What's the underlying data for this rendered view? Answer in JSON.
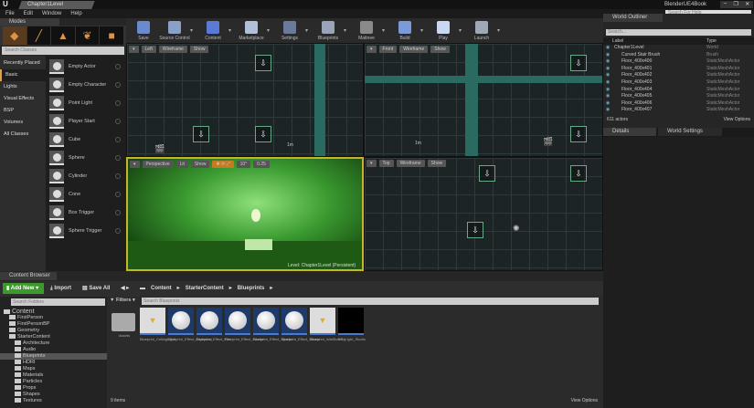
{
  "window": {
    "logo": "U",
    "doc_tab": "Chapter1Level",
    "app_title": "BlenderUE4Book",
    "search_web": "Search For Help",
    "controls": [
      "‒",
      "❐",
      "✕"
    ]
  },
  "menu": [
    "File",
    "Edit",
    "Window",
    "Help"
  ],
  "modes": {
    "tab": "Modes",
    "search_placeholder": "Search Classes",
    "mode_icons": [
      "place-mode",
      "paint-mode",
      "landscape-mode",
      "foliage-mode",
      "geometry-mode"
    ],
    "categories": [
      "Recently Placed",
      "Basic",
      "Lights",
      "Visual Effects",
      "BSP",
      "Volumes",
      "All Classes"
    ],
    "active_category": "Basic",
    "items": [
      "Empty Actor",
      "Empty Character",
      "Point Light",
      "Player Start",
      "Cube",
      "Sphere",
      "Cylinder",
      "Cone",
      "Box Trigger",
      "Sphere Trigger"
    ]
  },
  "toolbar": [
    {
      "label": "Save",
      "color": "#6a8ad0"
    },
    {
      "label": "Source Control",
      "color": "#8aa0c8"
    },
    {
      "label": "Content",
      "color": "#5a7ad8"
    },
    {
      "label": "Marketplace",
      "color": "#b0c0d8"
    },
    {
      "label": "Settings",
      "color": "#6a7a9a"
    },
    {
      "label": "Blueprints",
      "color": "#9aa4b8"
    },
    {
      "label": "Matinee",
      "color": "#8a8a8a"
    },
    {
      "label": "Build",
      "color": "#7a9ad8"
    },
    {
      "label": "Play",
      "color": "#c8d8f0"
    },
    {
      "label": "Launch",
      "color": "#a0a8b8"
    }
  ],
  "viewports": {
    "left": {
      "view": "Left",
      "mode": "Wireframe",
      "show": "Show",
      "scale": "1m"
    },
    "front": {
      "view": "Front",
      "mode": "Wireframe",
      "show": "Show",
      "scale": "1m"
    },
    "perspective": {
      "view": "Perspective",
      "mode": "Lit",
      "show": "Show",
      "angle": "10°",
      "scale": "0.25",
      "level_label": "Level:  Chapter1Level (Persistent)"
    },
    "top": {
      "view": "Top",
      "mode": "Wireframe",
      "show": "Show"
    }
  },
  "outliner": {
    "tab": "World Outliner",
    "search_placeholder": "Search...",
    "col_label": "Label",
    "col_type": "Type",
    "rows": [
      {
        "label": "Chapter1Level",
        "type": "World"
      },
      {
        "label": "Curved Stair Brush",
        "type": "Brush"
      },
      {
        "label": "Floor_400x400",
        "type": "StaticMeshActor"
      },
      {
        "label": "Floor_400x401",
        "type": "StaticMeshActor"
      },
      {
        "label": "Floor_400x402",
        "type": "StaticMeshActor"
      },
      {
        "label": "Floor_400x403",
        "type": "StaticMeshActor"
      },
      {
        "label": "Floor_400x404",
        "type": "StaticMeshActor"
      },
      {
        "label": "Floor_400x405",
        "type": "StaticMeshActor"
      },
      {
        "label": "Floor_400x406",
        "type": "StaticMeshActor"
      },
      {
        "label": "Floor_400x407",
        "type": "StaticMeshActor"
      }
    ],
    "count": "611 actors",
    "view_options": "View Options"
  },
  "details_tabs": [
    "Details",
    "World Settings"
  ],
  "content_browser": {
    "tab": "Content Browser",
    "add_new": "Add New",
    "import": "Import",
    "save_all": "Save All",
    "breadcrumb": [
      "Content",
      "StarterContent",
      "Blueprints"
    ],
    "search_folders": "Search Folders",
    "filters": "Filters",
    "search_assets": "Search Blueprints",
    "folders": [
      {
        "name": "Content",
        "depth": 0
      },
      {
        "name": "FirstPerson",
        "depth": 1
      },
      {
        "name": "FirstPersonBP",
        "depth": 1
      },
      {
        "name": "Geometry",
        "depth": 1
      },
      {
        "name": "StarterContent",
        "depth": 1
      },
      {
        "name": "Architecture",
        "depth": 2
      },
      {
        "name": "Audio",
        "depth": 2
      },
      {
        "name": "Blueprints",
        "depth": 2,
        "selected": true
      },
      {
        "name": "HDRI",
        "depth": 2
      },
      {
        "name": "Maps",
        "depth": 2
      },
      {
        "name": "Materials",
        "depth": 2
      },
      {
        "name": "Particles",
        "depth": 2
      },
      {
        "name": "Props",
        "depth": 2
      },
      {
        "name": "Shapes",
        "depth": 2
      },
      {
        "name": "Textures",
        "depth": 2
      }
    ],
    "assets": [
      {
        "name": "Assets",
        "kind": "folder"
      },
      {
        "name": "Blueprint_CeilingLight",
        "kind": "light"
      },
      {
        "name": "Blueprint_Effect_Explosion",
        "kind": "sphere"
      },
      {
        "name": "Blueprint_Effect_Fire",
        "kind": "sphere"
      },
      {
        "name": "Blueprint_Effect_Smoke",
        "kind": "sphere"
      },
      {
        "name": "Blueprint_Effect_Sparks",
        "kind": "sphere"
      },
      {
        "name": "Blueprint_Effect_Steam",
        "kind": "sphere"
      },
      {
        "name": "Blueprint_WallSconce",
        "kind": "sconce"
      },
      {
        "name": "BP_Light_Studio",
        "kind": "dark"
      }
    ],
    "count": "9 items",
    "view_options": "View Options"
  }
}
